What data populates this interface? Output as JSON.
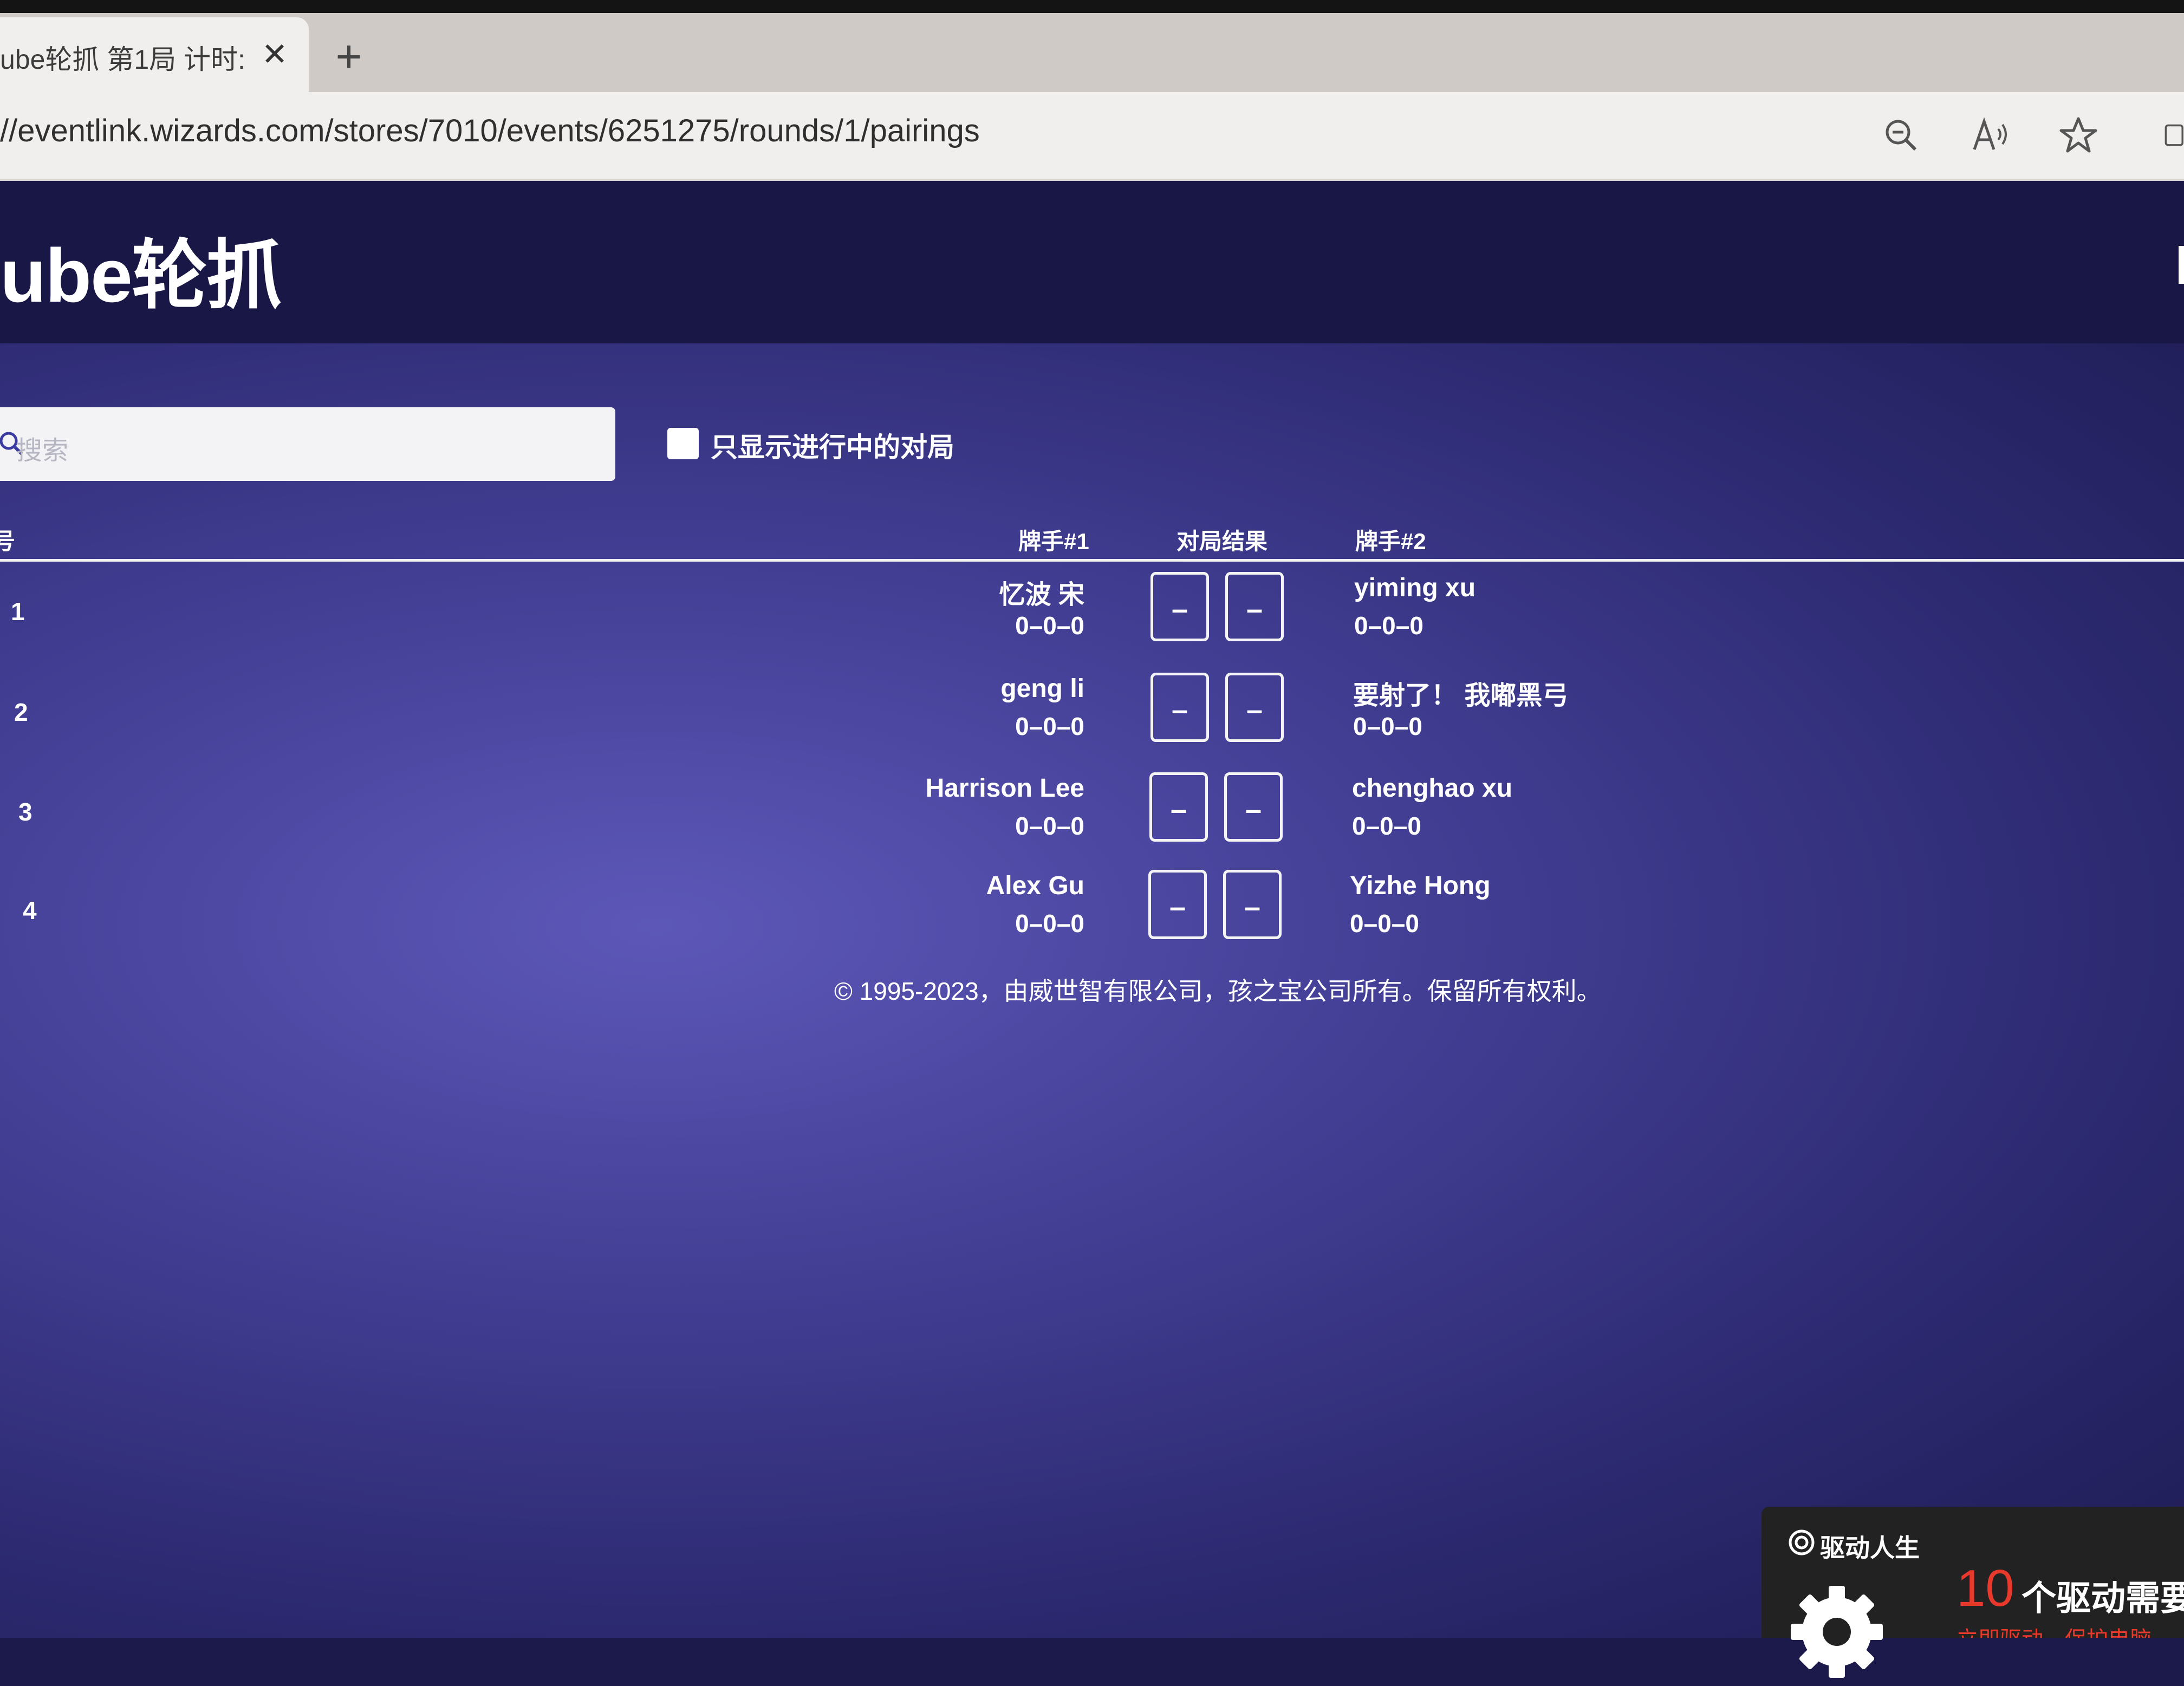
{
  "browser": {
    "tab_title": "ube轮抓 第1局 计时:",
    "tab_close": "✕",
    "new_tab": "+",
    "url": "//eventlink.wizards.com/stores/7010/events/6251275/rounds/1/pairings",
    "icons": [
      "zoom-out-icon",
      "read-aloud-icon",
      "favorite-star-icon",
      "sidebar-icon"
    ]
  },
  "header": {
    "title": "ube轮抓"
  },
  "controls": {
    "search_placeholder": "搜索",
    "filter_label": "只显示进行中的对局",
    "filter_checked": false
  },
  "table": {
    "columns": {
      "table_no": "桌号",
      "player1": "牌手#1",
      "result": "对局结果",
      "player2": "牌手#2"
    },
    "rows": [
      {
        "table": "1",
        "player1": "忆波 宋",
        "record1": "0–0–0",
        "result_a": "–",
        "result_b": "–",
        "player2": "yiming xu",
        "record2": "0–0–0"
      },
      {
        "table": "2",
        "player1": "geng li",
        "record1": "0–0–0",
        "result_a": "–",
        "result_b": "–",
        "player2": "要射了！ 我嘟黑弓",
        "record2": "0–0–0"
      },
      {
        "table": "3",
        "player1": "Harrison Lee",
        "record1": "0–0–0",
        "result_a": "–",
        "result_b": "–",
        "player2": "chenghao xu",
        "record2": "0–0–0"
      },
      {
        "table": "4",
        "player1": "Alex Gu",
        "record1": "0–0–0",
        "result_a": "–",
        "result_b": "–",
        "player2": "Yizhe Hong",
        "record2": "0–0–0"
      }
    ]
  },
  "footer": {
    "copyright": "© 1995-2023，由威世智有限公司，孩之宝公司所有。保留所有权利。"
  },
  "popup": {
    "brand": "驱动人生",
    "count": "10",
    "text": "个驱动需要",
    "subtext": "立即驱动，保护电脑"
  },
  "colors": {
    "page_header_bg": "#191745",
    "main_bg": "#433f95",
    "accent_red": "#e8392d"
  }
}
